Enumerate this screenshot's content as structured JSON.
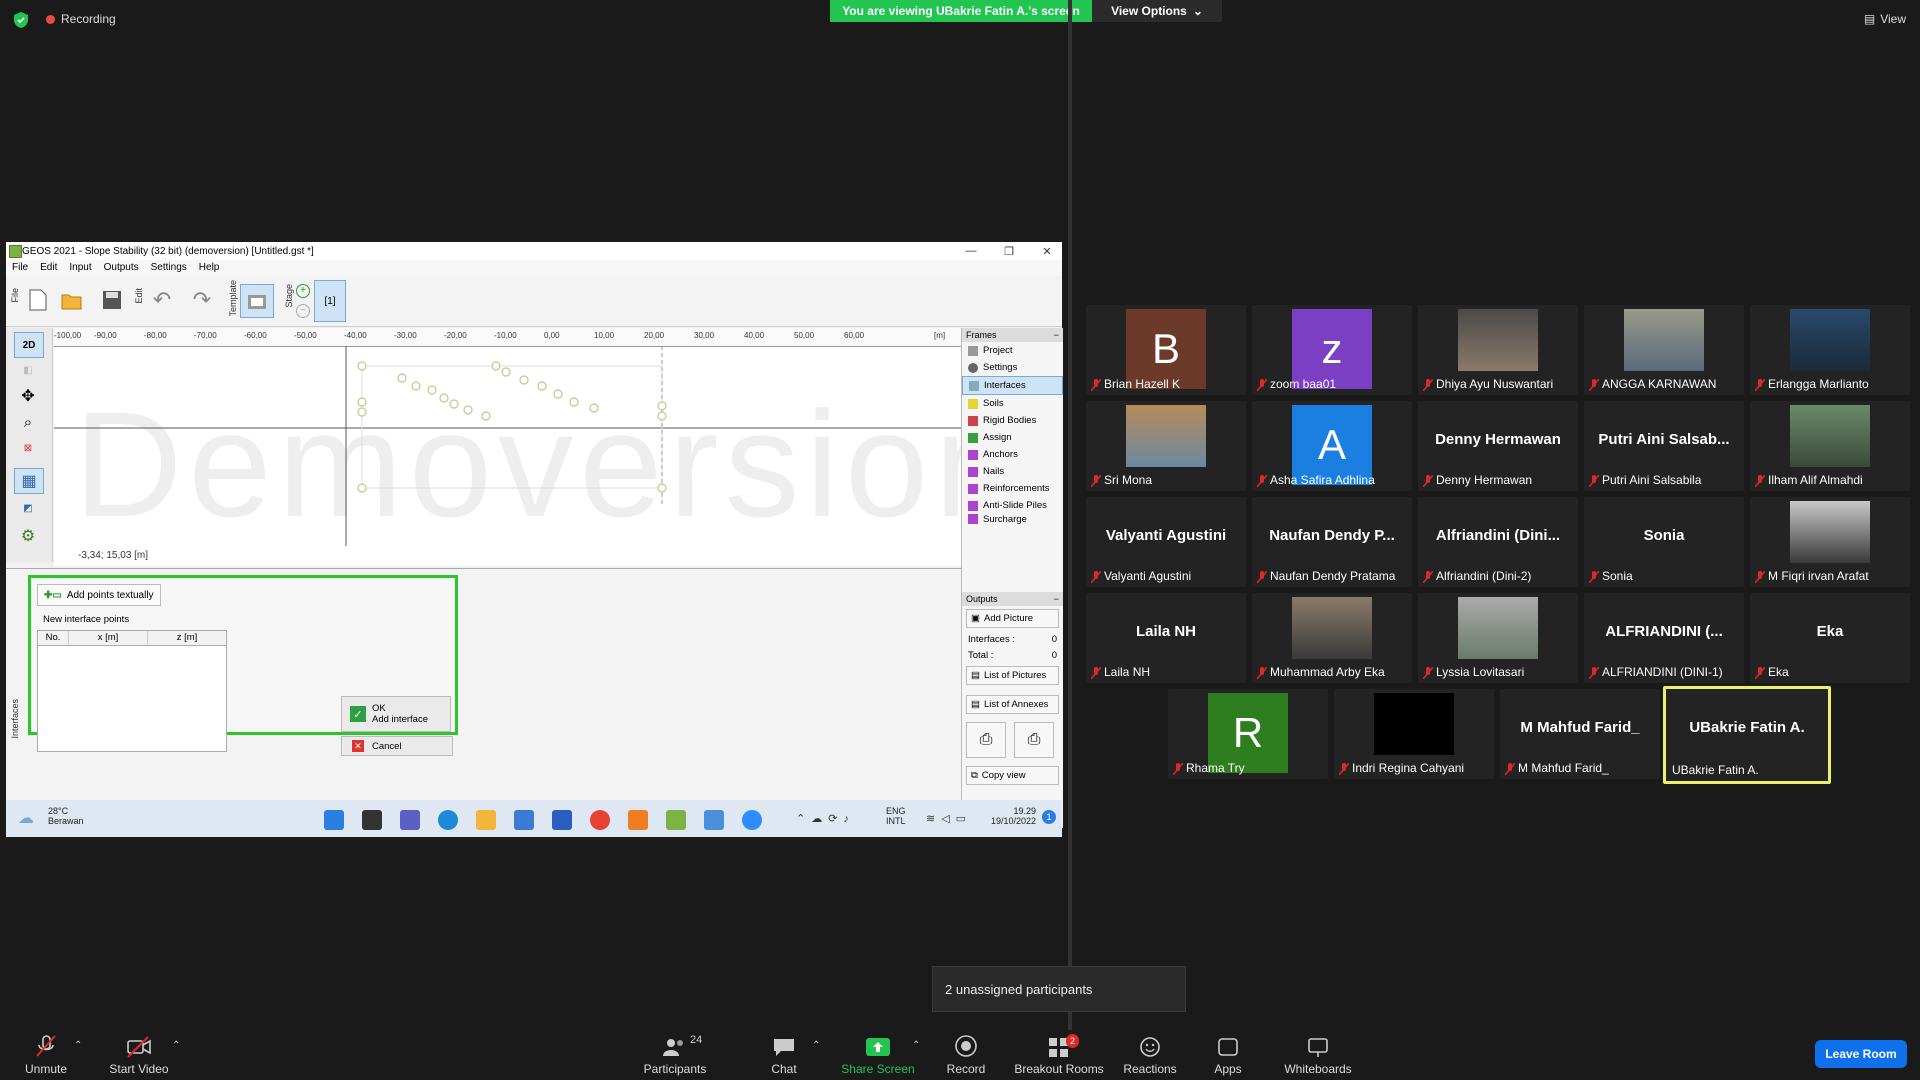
{
  "zoom": {
    "recording_label": "Recording",
    "viewing_banner": "You are viewing UBakrie Fatin A.'s screen",
    "view_options": "View Options",
    "view_label": "View",
    "unassigned_popup": "2 unassigned participants",
    "leave_room": "Leave Room",
    "participants_count": "24",
    "breakout_badge": "2",
    "bottom_bar": {
      "unmute": "Unmute",
      "start_video": "Start Video",
      "participants": "Participants",
      "chat": "Chat",
      "share_screen": "Share Screen",
      "record": "Record",
      "breakout_rooms": "Breakout Rooms",
      "reactions": "Reactions",
      "apps": "Apps",
      "whiteboards": "Whiteboards"
    },
    "participants": [
      {
        "name": "Brian Hazell K",
        "initial": "B",
        "color": "#6b3a2a"
      },
      {
        "name": "zoom baa01",
        "initial": "z",
        "color": "#7b3fc4"
      },
      {
        "name": "Dhiya Ayu Nuswantari",
        "photo": true
      },
      {
        "name": "ANGGA KARNAWAN",
        "photo": true
      },
      {
        "name": "Erlangga Marlianto",
        "photo": true
      },
      {
        "name": "Sri Mona",
        "photo": true
      },
      {
        "name": "Asha Safira Adhlina",
        "initial": "A",
        "color": "#1a7fe0"
      },
      {
        "name": "Denny Hermawan",
        "big": "Denny Hermawan"
      },
      {
        "name": "Putri Aini Salsabila",
        "big": "Putri Aini Salsab..."
      },
      {
        "name": "Ilham Alif Almahdi",
        "photo": true
      },
      {
        "name": "Valyanti Agustini",
        "big": "Valyanti Agustini"
      },
      {
        "name": "Naufan Dendy Pratama",
        "big": "Naufan Dendy P..."
      },
      {
        "name": "Alfriandini (Dini-2)",
        "big": "Alfriandini  (Dini..."
      },
      {
        "name": "Sonia",
        "big": "Sonia"
      },
      {
        "name": "M Fiqri irvan Arafat",
        "photo": true
      },
      {
        "name": "Laila NH",
        "big": "Laila NH"
      },
      {
        "name": "Muhammad Arby Eka",
        "photo": true
      },
      {
        "name": "Lyssia Lovitasari",
        "photo": true
      },
      {
        "name": "ALFRIANDINI (DINI-1)",
        "big": "ALFRIANDINI (..."
      },
      {
        "name": "Eka",
        "big": "Eka"
      },
      {
        "name": "Rhama Try",
        "initial": "R",
        "color": "#2e7d1f"
      },
      {
        "name": "Indri Regina Cahyani",
        "black": true
      },
      {
        "name": "M Mahfud Farid_",
        "big": "M Mahfud Farid_"
      },
      {
        "name": "UBakrie Fatin A.",
        "big": "UBakrie Fatin A.",
        "active": true
      }
    ]
  },
  "app": {
    "title": "GEOS 2021 - Slope Stability (32 bit) (demoversion) [Untitled.gst *]",
    "menu": [
      "File",
      "Edit",
      "Input",
      "Outputs",
      "Settings",
      "Help"
    ],
    "toolbar_labels": {
      "file": "File",
      "edit": "Edit",
      "template": "Template",
      "stage": "Stage",
      "stage_num": "[1]"
    },
    "left_tool_2d": "2D",
    "ruler": [
      "-100,00",
      "-90,00",
      "-80,00",
      "-70,00",
      "-60,00",
      "-50,00",
      "-40,00",
      "-30,00",
      "-20,00",
      "-10,00",
      "0,00",
      "10,00",
      "20,00",
      "30,00",
      "40,00",
      "50,00",
      "60,00",
      "[m]"
    ],
    "watermark": "Demoversion",
    "coords": "-3,34; 15,03 [m]",
    "frames_header": "Frames",
    "frames": [
      "Project",
      "Settings",
      "Interfaces",
      "Soils",
      "Rigid Bodies",
      "Assign",
      "Anchors",
      "Nails",
      "Reinforcements",
      "Anti-Slide Piles",
      "Surcharge"
    ],
    "outputs_header": "Outputs",
    "add_picture": "Add Picture",
    "interfaces_label": "Interfaces :",
    "interfaces_val": "0",
    "total_label": "Total :",
    "total_val": "0",
    "list_pictures": "List of Pictures",
    "list_annexes": "List of Annexes",
    "copy_view": "Copy view",
    "panel_side_label": "Interfaces",
    "add_points_textually": "Add points textually",
    "new_interface_points": "New interface points",
    "table_headers": [
      "No.",
      "x [m]",
      "z [m]"
    ],
    "ok_label": "OK",
    "ok_sub": "Add interface",
    "cancel_label": "Cancel",
    "weather_temp": "28°C",
    "weather_desc": "Berawan",
    "lang1": "ENG",
    "lang2": "INTL",
    "time": "19.29",
    "date": "19/10/2022",
    "notif": "1"
  }
}
